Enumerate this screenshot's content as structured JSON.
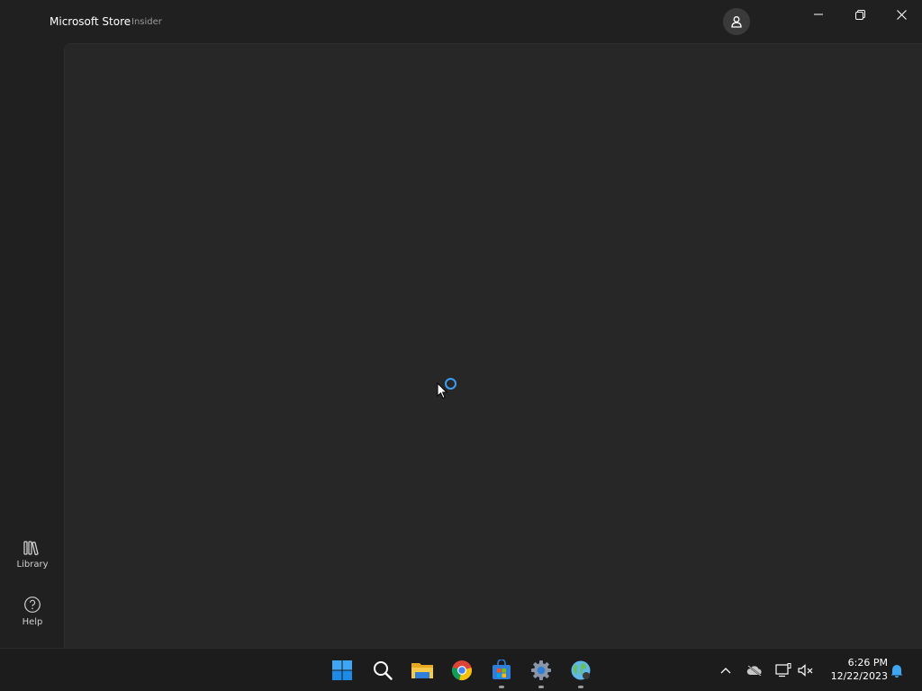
{
  "app": {
    "title": "Microsoft Store",
    "badge": "Insider"
  },
  "titlebar": {
    "account_icon": "person-icon",
    "minimize_icon": "minimize-icon",
    "restore_icon": "restore-icon",
    "close_icon": "close-icon"
  },
  "sidebar": {
    "items": [
      {
        "label": "Library",
        "icon": "library-icon"
      },
      {
        "label": "Help",
        "icon": "help-icon"
      }
    ]
  },
  "content": {
    "state": "loading",
    "spinner_color": "#3b9cf2"
  },
  "taskbar": {
    "apps": [
      {
        "name": "Start",
        "icon": "windows-start-icon",
        "running": false
      },
      {
        "name": "Search",
        "icon": "search-icon",
        "running": false
      },
      {
        "name": "File Explorer",
        "icon": "folder-icon",
        "running": false
      },
      {
        "name": "Google Chrome",
        "icon": "chrome-icon",
        "running": false
      },
      {
        "name": "Microsoft Store",
        "icon": "store-icon",
        "running": true
      },
      {
        "name": "Settings",
        "icon": "settings-gear-icon",
        "running": true
      },
      {
        "name": "Network app",
        "icon": "globe-icon",
        "running": true
      }
    ],
    "tray": {
      "icons": [
        "chevron-up-icon",
        "onedrive-offline-icon",
        "network-icon",
        "volume-muted-icon",
        "notification-bell-icon"
      ],
      "time": "6:26 PM",
      "date": "12/22/2023"
    }
  }
}
